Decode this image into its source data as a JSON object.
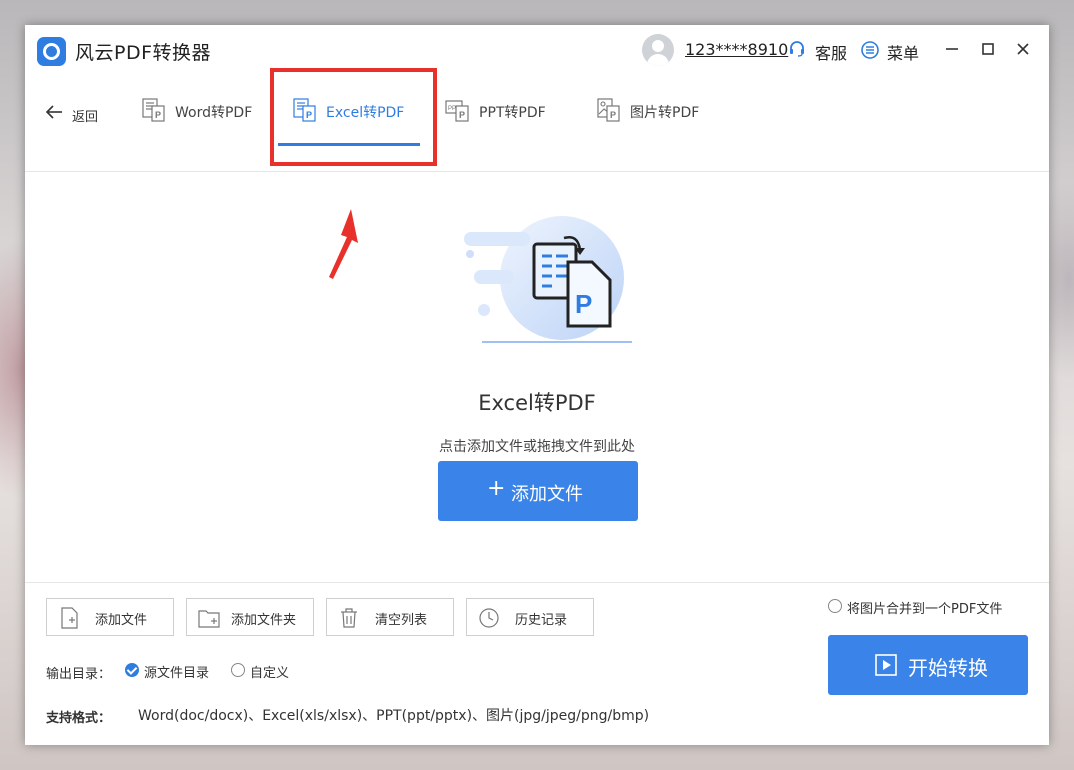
{
  "app": {
    "title": "风云PDF转换器"
  },
  "header": {
    "username": "123****8910",
    "service_label": "客服",
    "menu_label": "菜单"
  },
  "nav": {
    "back_label": "返回",
    "tabs": [
      {
        "label": "Word转PDF",
        "icon": "word-pdf-icon",
        "active": false
      },
      {
        "label": "Excel转PDF",
        "icon": "excel-pdf-icon",
        "active": true
      },
      {
        "label": "PPT转PDF",
        "icon": "ppt-pdf-icon",
        "active": false
      },
      {
        "label": "图片转PDF",
        "icon": "image-pdf-icon",
        "active": false
      }
    ]
  },
  "hero": {
    "title": "Excel转PDF",
    "subtitle": "点击添加文件或拖拽文件到此处",
    "add_button_label": "添加文件"
  },
  "toolbar": {
    "buttons": [
      {
        "label": "添加文件",
        "icon": "add-file-icon"
      },
      {
        "label": "添加文件夹",
        "icon": "add-folder-icon"
      },
      {
        "label": "清空列表",
        "icon": "trash-icon"
      },
      {
        "label": "历史记录",
        "icon": "history-icon"
      }
    ]
  },
  "options": {
    "merge_label": "将图片合并到一个PDF文件",
    "merge_checked": false,
    "output_label": "输出目录：",
    "output_options": [
      {
        "label": "源文件目录",
        "checked": true
      },
      {
        "label": "自定义",
        "checked": false
      }
    ],
    "formats_label": "支持格式：",
    "formats_value": "Word(doc/docx)、Excel(xls/xlsx)、PPT(ppt/pptx)、图片(jpg/jpeg/png/bmp)"
  },
  "start_button_label": "开始转换",
  "colors": {
    "accent": "#2f7de1",
    "button": "#3a83e8",
    "annotation_red": "#e8312b"
  }
}
